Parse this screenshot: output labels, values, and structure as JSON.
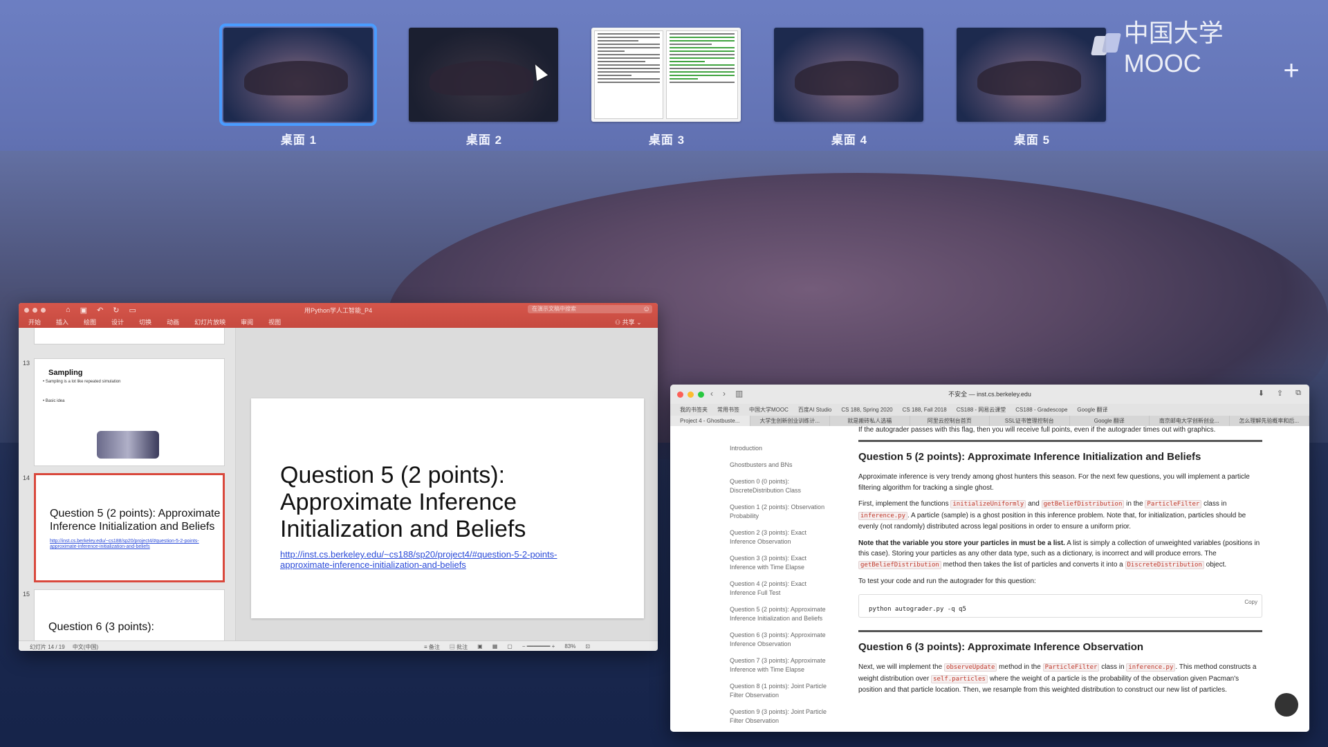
{
  "spaces": [
    {
      "label": "桌面 1",
      "active": true
    },
    {
      "label": "桌面 2",
      "active": false
    },
    {
      "label": "桌面 3",
      "active": false
    },
    {
      "label": "桌面 4",
      "active": false
    },
    {
      "label": "桌面 5",
      "active": false
    }
  ],
  "brand": {
    "logo_text": "中国大学MOOC"
  },
  "add_space_symbol": "+",
  "ppt": {
    "window_title": "用Python学人工智能_P4",
    "search_placeholder": "在演示文稿中搜索",
    "ribbon_tabs": [
      "开始",
      "插入",
      "绘图",
      "设计",
      "切换",
      "动画",
      "幻灯片放映",
      "审阅",
      "视图"
    ],
    "share": "共享",
    "thumbnails": [
      {
        "num": "13",
        "title": "Sampling",
        "bullets": [
          "• Sampling is a lot like repeated simulation",
          "• Basic idea"
        ]
      },
      {
        "num": "14",
        "title": "Question 5 (2 points): Approximate Inference Initialization and Beliefs",
        "link": "http://inst.cs.berkeley.edu/~cs188/sp20/project4/#question-5-2-points-approximate-inference-initialization-and-beliefs"
      },
      {
        "num": "15",
        "title": "Question 6 (3 points):"
      }
    ],
    "slide": {
      "title": "Question 5 (2 points): Approximate Inference Initialization and Beliefs",
      "link": "http://inst.cs.berkeley.edu/~cs188/sp20/project4/#question-5-2-points-approximate-inference-initialization-and-beliefs"
    },
    "status": {
      "slide_count": "幻灯片 14 / 19",
      "language": "中文(中国)",
      "notes": "备注",
      "comments": "批注",
      "zoom": "83%"
    }
  },
  "safari": {
    "address": "不安全 — inst.cs.berkeley.edu",
    "bookmarks": [
      "我的书签夹",
      "常用书签",
      "中国大学MOOC",
      "百度AI Studio",
      "CS 188, Spring 2020",
      "CS 188, Fall 2018",
      "CS188 - 网易云课堂",
      "CS188 - Gradescope",
      "Google 翻译"
    ],
    "tabs": [
      "Project 4 - Ghostbuste...",
      "大学生创新创业训练计...",
      "就是搬砖私人选福",
      "阿里云控制台首页",
      "SSL证书管理控制台",
      "Google 翻译",
      "南京邮电大学创新创业...",
      "怎么理解先验概率和后..."
    ],
    "toc": [
      "Introduction",
      "Ghostbusters and BNs",
      "Question 0 (0 points): DiscreteDistribution Class",
      "Question 1 (2 points): Observation Probability",
      "Question 2 (3 points): Exact Inference Observation",
      "Question 3 (3 points): Exact Inference with Time Elapse",
      "Question 4 (2 points): Exact Inference Full Test",
      "Question 5 (2 points): Approximate Inference Initialization and Beliefs",
      "Question 6 (3 points): Approximate Inference Observation",
      "Question 7 (3 points): Approximate Inference with Time Elapse",
      "Question 8 (1 points): Joint Particle Filter Observation",
      "Question 9 (3 points): Joint Particle Filter Observation"
    ],
    "intro_line": "If the autograder passes with this flag, then you will receive full points, even if the autograder times out with graphics.",
    "q5": {
      "heading": "Question 5 (2 points): Approximate Inference Initialization and Beliefs",
      "p1": "Approximate inference is very trendy among ghost hunters this season. For the next few questions, you will implement a particle filtering algorithm for tracking a single ghost.",
      "p2_a": "First, implement the functions",
      "code_init": "initializeUniformly",
      "p2_and": "and",
      "code_get": "getBeliefDistribution",
      "p2_in": "in the",
      "code_pf": "ParticleFilter",
      "p2_class": "class in",
      "code_inf": "inference.py",
      "p2_b": ". A particle (sample) is a ghost position in this inference problem. Note that, for initialization, particles should be evenly (not randomly) distributed across legal positions in order to ensure a uniform prior.",
      "p3_bold": "Note that the variable you store your particles in must be a list.",
      "p3_a": "A list is simply a collection of unweighted variables (positions in this case). Storing your particles as any other data type, such as a dictionary, is incorrect and will produce errors. The",
      "p3_code": "getBeliefDistribution",
      "p3_b": "method then takes the list of particles and converts it into a",
      "p3_code2": "DiscreteDistribution",
      "p3_c": "object.",
      "p4": "To test your code and run the autograder for this question:",
      "command": "python autograder.py -q q5",
      "copy": "Copy"
    },
    "q6": {
      "heading": "Question 6 (3 points): Approximate Inference Observation",
      "p_a": "Next, we will implement the",
      "code_obs": "observeUpdate",
      "p_b": "method in the",
      "code_pf": "ParticleFilter",
      "p_c": "class in",
      "code_inf": "inference.py",
      "p_d": ". This method constructs a weight distribution over",
      "code_self": "self.particles",
      "p_e": "where the weight of a particle is the probability of the observation given Pacman's position and that particle location. Then, we resample from this weighted distribution to construct our new list of particles."
    }
  },
  "colors": {
    "accent": "#4a9cff",
    "ppt_red": "#d6564b",
    "code_red": "#c0392b"
  }
}
